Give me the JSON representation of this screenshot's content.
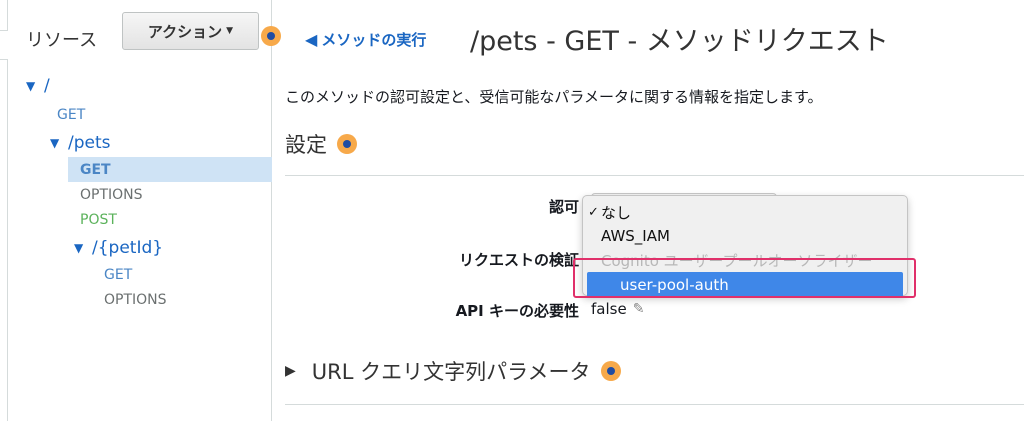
{
  "sidebar": {
    "title": "リソース",
    "actions_label": "アクション",
    "tree": [
      {
        "type": "path",
        "label": "/"
      },
      {
        "type": "method",
        "label": "GET"
      },
      {
        "type": "path",
        "label": "/pets"
      },
      {
        "type": "method",
        "label": "GET",
        "selected": true
      },
      {
        "type": "method",
        "label": "OPTIONS"
      },
      {
        "type": "method",
        "label": "POST"
      },
      {
        "type": "path",
        "label": "/{petId}"
      },
      {
        "type": "method",
        "label": "GET"
      },
      {
        "type": "method",
        "label": "OPTIONS"
      }
    ]
  },
  "main": {
    "back_link": "メソッドの実行",
    "title": "/pets - GET - メソッドリクエスト",
    "description": "このメソッドの認可設定と、受信可能なパラメータに関する情報を指定します。",
    "settings_heading": "設定",
    "fields": {
      "auth_label": "認可",
      "request_validation_label": "リクエストの検証",
      "api_key_label": "API キーの必要性",
      "api_key_value": "false"
    },
    "dropdown": {
      "options": [
        {
          "label": "なし",
          "checked": true
        },
        {
          "label": "AWS_IAM"
        },
        {
          "label": "Cognito ユーザープールオーソライザー",
          "disabled": true
        },
        {
          "label": "user-pool-auth",
          "highlighted": true
        }
      ]
    },
    "url_section_label": "URL クエリ文字列パラメータ"
  },
  "colors": {
    "link": "#1a66c2",
    "highlight": "#3f87e8",
    "callout": "#e0306a",
    "info": "#f7a94a",
    "post": "#5bb25b"
  }
}
